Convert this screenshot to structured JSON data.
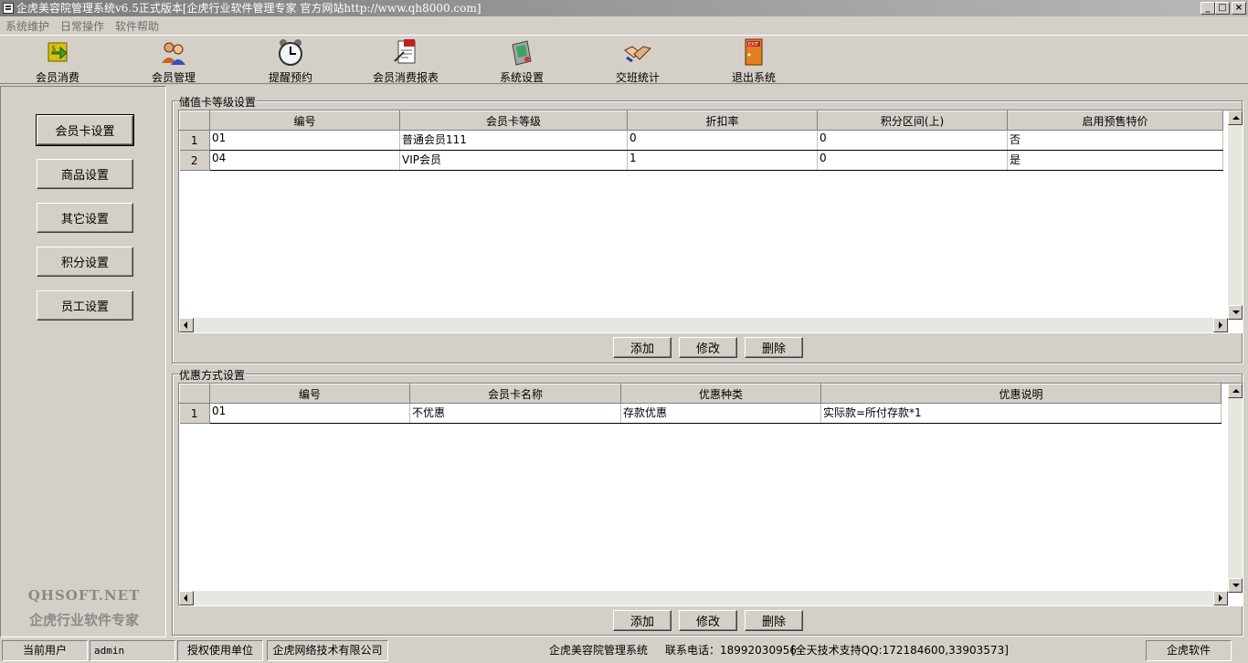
{
  "window": {
    "title": "企虎美容院管理系统v6.5正式版本[企虎行业软件管理专家 官方网站http://www.qh8000.com]",
    "min": "_",
    "max": "□",
    "close": "×"
  },
  "menu": [
    "系统维护",
    "日常操作",
    "软件帮助"
  ],
  "toolbar": [
    {
      "label": "会员消费",
      "icon": "member-consume-icon"
    },
    {
      "label": "会员管理",
      "icon": "member-manage-icon"
    },
    {
      "label": "提醒预约",
      "icon": "alarm-clock-icon"
    },
    {
      "label": "会员消费报表",
      "icon": "report-icon"
    },
    {
      "label": "系统设置",
      "icon": "settings-icon"
    },
    {
      "label": "交班统计",
      "icon": "handshake-icon"
    },
    {
      "label": "退出系统",
      "icon": "exit-door-icon"
    }
  ],
  "exit_sign": "EXIT",
  "nav": [
    "会员卡设置",
    "商品设置",
    "其它设置",
    "积分设置",
    "员工设置"
  ],
  "brand": {
    "en": "QHSOFT.NET",
    "cn": "企虎行业软件专家"
  },
  "card_levels": {
    "title": "储值卡等级设置",
    "columns": [
      "编号",
      "会员卡等级",
      "折扣率",
      "积分区间(上)",
      "启用预售特价"
    ],
    "rows": [
      {
        "n": "1",
        "cells": [
          "01",
          "普通会员111",
          "0",
          "0",
          "否"
        ]
      },
      {
        "n": "2",
        "cells": [
          "04",
          "VIP会员",
          "1",
          "0",
          "是"
        ]
      }
    ],
    "buttons": [
      "添加",
      "修改",
      "删除"
    ]
  },
  "discounts": {
    "title": "优惠方式设置",
    "columns": [
      "编号",
      "会员卡名称",
      "优惠种类",
      "优惠说明"
    ],
    "rows": [
      {
        "n": "1",
        "cells": [
          "01",
          "不优惠",
          "存款优惠",
          "实际款=所付存款*1"
        ]
      }
    ],
    "buttons": [
      "添加",
      "修改",
      "删除"
    ]
  },
  "status": {
    "user_label": "当前用户",
    "user": "admin",
    "auth_label": "授权使用单位",
    "company": "企虎网络技术有限公司",
    "app": "企虎美容院管理系统",
    "phone": "联系电话：18992030956",
    "support": "[全天技术支持QQ:172184600,33903573]",
    "vendor": "企虎软件"
  }
}
